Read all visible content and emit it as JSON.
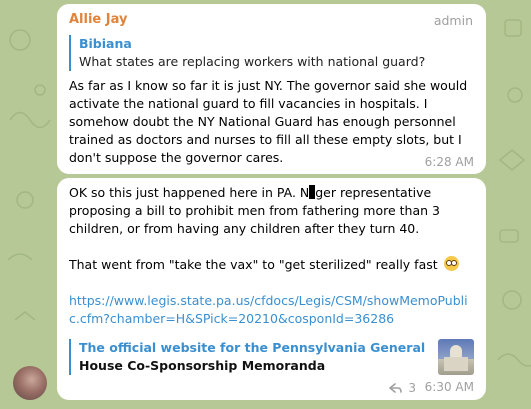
{
  "message1": {
    "sender": "Allie Jay",
    "role": "admin",
    "reply_to": {
      "name": "Bibiana",
      "text": "What states are replacing workers with national guard?"
    },
    "text": "As far as I know so far it is just NY. The governor said she would activate the national guard to fill vacancies in hospitals. I somehow doubt the NY National Guard has enough personnel trained as doctors and nurses to fill all these empty slots, but I don't suppose the governor cares.",
    "time": "6:28 AM"
  },
  "message2": {
    "text_part1a": "OK so this just happened here in PA. N",
    "text_part1b": "ger representative proposing a bill to prohibit men from fathering more than 3 children, or from having any children after they turn 40.",
    "text_part2": "That went from \"take the vax\" to \"get sterilized\" really fast",
    "emoji": "flushed-face",
    "link": "https://www.legis.state.pa.us/cfdocs/Legis/CSM/showMemoPublic.cfm?chamber=H&SPick=20210&cosponId=36286",
    "preview": {
      "site": "The official website for the Pennsylvania General Asse...",
      "title": "House Co-Sponsorship Memoranda"
    },
    "forward_count": "3",
    "time": "6:30 AM"
  },
  "colors": {
    "background": "#b5c896",
    "sender_name": "#e0843b",
    "link": "#3a8fd0"
  }
}
